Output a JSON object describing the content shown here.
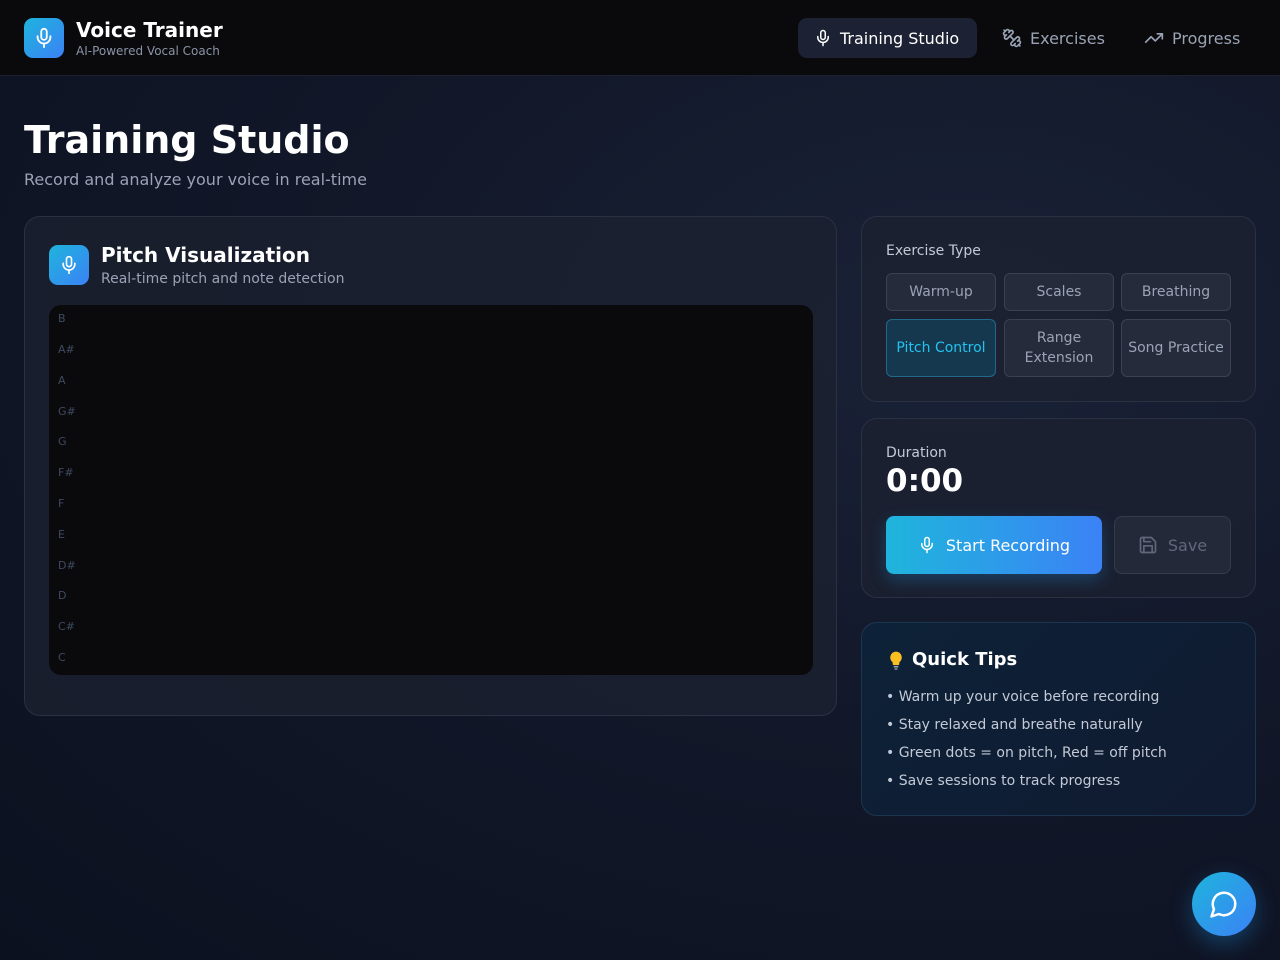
{
  "header": {
    "app_title": "Voice Trainer",
    "app_subtitle": "AI-Powered Vocal Coach",
    "logo_icon": "microphone-icon",
    "nav": [
      {
        "label": "Training Studio",
        "icon": "microphone-icon",
        "active": true
      },
      {
        "label": "Exercises",
        "icon": "dumbbell-icon",
        "active": false
      },
      {
        "label": "Progress",
        "icon": "trending-up-icon",
        "active": false
      }
    ]
  },
  "page": {
    "title": "Training Studio",
    "subtitle": "Record and analyze your voice in real-time"
  },
  "visualization": {
    "title": "Pitch Visualization",
    "subtitle": "Real-time pitch and note detection",
    "notes": [
      "B",
      "A#",
      "A",
      "G#",
      "G",
      "F#",
      "F",
      "E",
      "D#",
      "D",
      "C#",
      "C"
    ]
  },
  "exercise": {
    "label": "Exercise Type",
    "options": [
      "Warm-up",
      "Scales",
      "Breathing",
      "Pitch Control",
      "Range Extension",
      "Song Practice"
    ],
    "selected": "Pitch Control"
  },
  "recording": {
    "duration_label": "Duration",
    "duration_value": "0:00",
    "start_label": "Start Recording",
    "save_label": "Save"
  },
  "tips": {
    "title": "Quick Tips",
    "icon": "lightbulb-icon",
    "items": [
      "• Warm up your voice before recording",
      "• Stay relaxed and breathe naturally",
      "• Green dots = on pitch, Red = off pitch",
      "• Save sessions to track progress"
    ]
  },
  "colors": {
    "accent": "#22c3ee",
    "accent_gradient_start": "#1eb4dc",
    "accent_gradient_end": "#3b82f6",
    "background": "#121829"
  }
}
